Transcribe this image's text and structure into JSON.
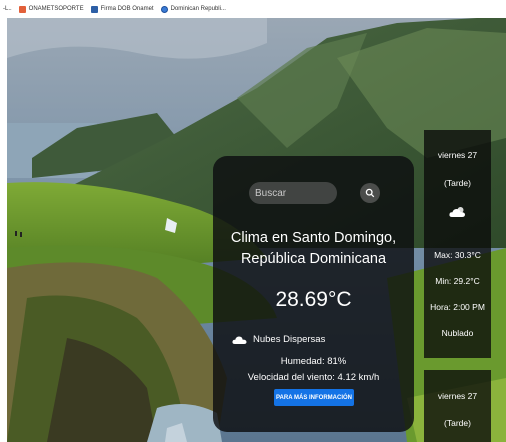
{
  "bookmarks": [
    {
      "label": "-L..",
      "icon": "none"
    },
    {
      "label": "ONAMETSOPORTE",
      "icon": "bookmark-app-icon"
    },
    {
      "label": "Firma DOB Onamet",
      "icon": "document-icon"
    },
    {
      "label": "Dominican Republi...",
      "icon": "globe-icon"
    }
  ],
  "search": {
    "placeholder": "Buscar",
    "value": ""
  },
  "weather": {
    "city_line1": "Clima en Santo Domingo,",
    "city_line2": "República Dominicana",
    "temperature": "28.69°C",
    "condition": "Nubes Dispersas",
    "humidity": "Humedad: 81%",
    "wind": "Velocidad del viento: 4.12 km/h",
    "more_button": "PARA MÁS INFORMACIÓN"
  },
  "forecast": [
    {
      "day": "viernes 27",
      "period": "(Tarde)",
      "max": "Max: 30.3°C",
      "min": "Min: 29.2°C",
      "hour": "Hora: 2:00 PM",
      "description": "Nublado"
    },
    {
      "day": "viernes 27",
      "period": "(Tarde)"
    }
  ],
  "colors": {
    "accent_button": "#1473e6",
    "panel_bg": "#0c0e10",
    "sky": "#6f8aa3",
    "grass": "#6f9a2c"
  }
}
